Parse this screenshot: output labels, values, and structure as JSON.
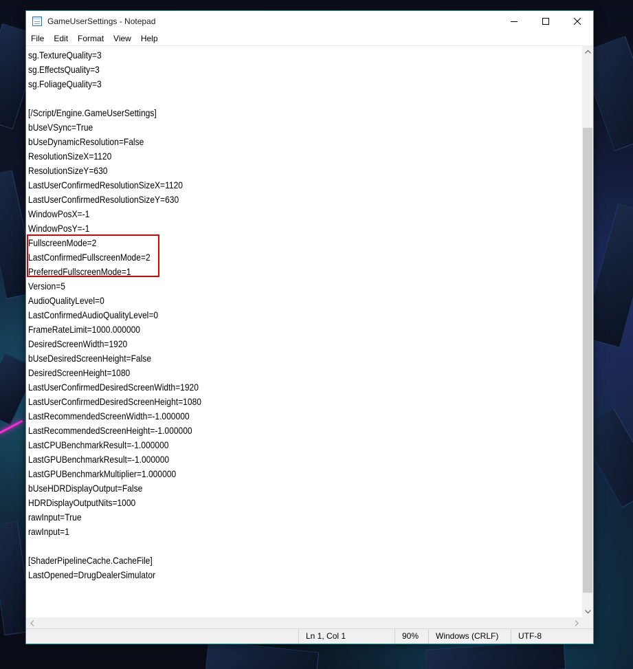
{
  "window": {
    "title": "GameUserSettings - Notepad"
  },
  "menu": {
    "items": [
      "File",
      "Edit",
      "Format",
      "View",
      "Help"
    ]
  },
  "document": {
    "lines": [
      "sg.TextureQuality=3",
      "sg.EffectsQuality=3",
      "sg.FoliageQuality=3",
      "",
      "[/Script/Engine.GameUserSettings]",
      "bUseVSync=True",
      "bUseDynamicResolution=False",
      "ResolutionSizeX=1120",
      "ResolutionSizeY=630",
      "LastUserConfirmedResolutionSizeX=1120",
      "LastUserConfirmedResolutionSizeY=630",
      "WindowPosX=-1",
      "WindowPosY=-1",
      "FullscreenMode=2",
      "LastConfirmedFullscreenMode=2",
      "PreferredFullscreenMode=1",
      "Version=5",
      "AudioQualityLevel=0",
      "LastConfirmedAudioQualityLevel=0",
      "FrameRateLimit=1000.000000",
      "DesiredScreenWidth=1920",
      "bUseDesiredScreenHeight=False",
      "DesiredScreenHeight=1080",
      "LastUserConfirmedDesiredScreenWidth=1920",
      "LastUserConfirmedDesiredScreenHeight=1080",
      "LastRecommendedScreenWidth=-1.000000",
      "LastRecommendedScreenHeight=-1.000000",
      "LastCPUBenchmarkResult=-1.000000",
      "LastGPUBenchmarkResult=-1.000000",
      "LastGPUBenchmarkMultiplier=1.000000",
      "bUseHDRDisplayOutput=False",
      "HDRDisplayOutputNits=1000",
      "rawInput=True",
      "rawInput=1",
      "",
      "[ShaderPipelineCache.CacheFile]",
      "LastOpened=DrugDealerSimulator"
    ]
  },
  "status": {
    "position": "Ln 1, Col 1",
    "zoom": "90%",
    "line_ending": "Windows (CRLF)",
    "encoding": "UTF-8"
  },
  "colors": {
    "highlight_border": "#e00000",
    "window_border": "#1aa3a3"
  }
}
